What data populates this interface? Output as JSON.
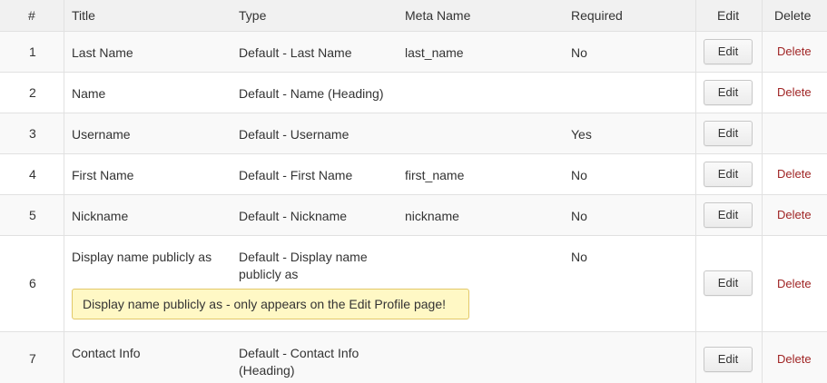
{
  "header": {
    "num": "#",
    "title": "Title",
    "type": "Type",
    "meta": "Meta Name",
    "required": "Required",
    "edit": "Edit",
    "delete": "Delete"
  },
  "rows": [
    {
      "num": "1",
      "title": "Last Name",
      "type": "Default - Last Name",
      "meta": "last_name",
      "required": "No",
      "edit": "Edit",
      "delete": "Delete"
    },
    {
      "num": "2",
      "title": "Name",
      "type": "Default - Name (Heading)",
      "meta": "",
      "required": "",
      "edit": "Edit",
      "delete": "Delete"
    },
    {
      "num": "3",
      "title": "Username",
      "type": "Default - Username",
      "meta": "",
      "required": "Yes",
      "edit": "Edit",
      "delete": ""
    },
    {
      "num": "4",
      "title": "First Name",
      "type": "Default - First Name",
      "meta": "first_name",
      "required": "No",
      "edit": "Edit",
      "delete": "Delete"
    },
    {
      "num": "5",
      "title": "Nickname",
      "type": "Default - Nickname",
      "meta": "nickname",
      "required": "No",
      "edit": "Edit",
      "delete": "Delete"
    },
    {
      "num": "6",
      "title": "Display name publicly as",
      "type_line1": "Default - Display name",
      "type_line2": "publicly as",
      "meta": "",
      "required": "No",
      "edit": "Edit",
      "delete": "Delete",
      "notice": "Display name publicly as - only appears on the Edit Profile page!"
    },
    {
      "num": "7",
      "title": "Contact Info",
      "type_line1": "Default - Contact Info",
      "type_line2": "(Heading)",
      "meta": "",
      "required": "",
      "edit": "Edit",
      "delete": "Delete"
    }
  ],
  "colors": {
    "header_bg": "#f1f1f1",
    "alt_row_bg": "#f9f9f9",
    "delete_link": "#a02525",
    "notice_bg": "#fff8c5",
    "notice_border": "#e2c869"
  }
}
